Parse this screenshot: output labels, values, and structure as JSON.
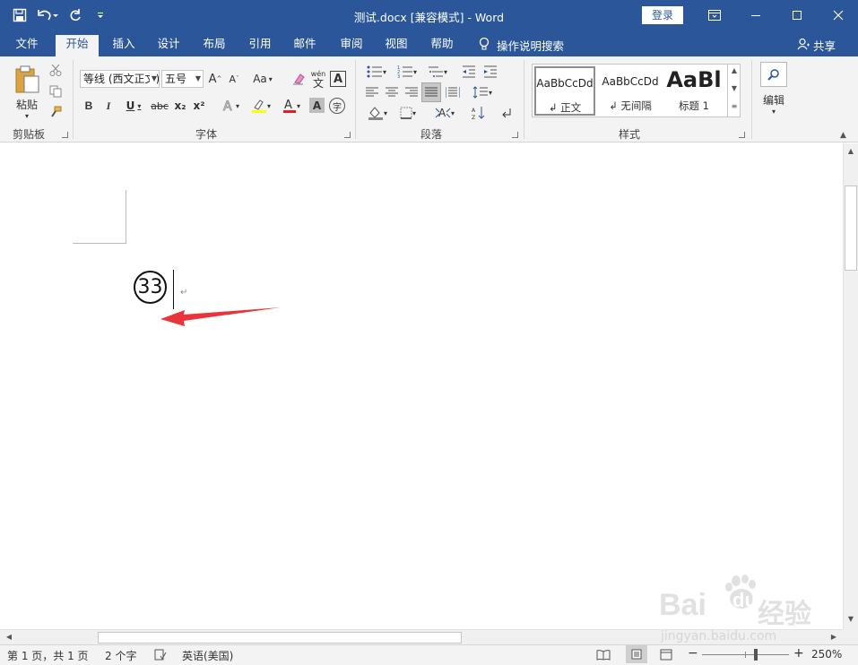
{
  "window": {
    "title": "测试.docx [兼容模式]  -  Word",
    "login_label": "登录"
  },
  "menu": {
    "tabs": [
      "文件",
      "开始",
      "插入",
      "设计",
      "布局",
      "引用",
      "邮件",
      "审阅",
      "视图",
      "帮助"
    ],
    "active_tab": "开始",
    "tell_me": "操作说明搜索",
    "share": "共享"
  },
  "ribbon": {
    "clipboard": {
      "label": "剪贴板",
      "paste": "粘贴"
    },
    "font": {
      "label": "字体",
      "font_name": "等线 (西文正文)",
      "font_size": "五号",
      "case_label": "Aa",
      "pinyin_top": "wén",
      "pinyin_bottom": "文",
      "boxed_char": "A",
      "enclose_char": "字",
      "bold": "B",
      "italic": "I",
      "underline": "U",
      "strike": "abc",
      "subscript": "x₂",
      "superscript": "x²"
    },
    "paragraph": {
      "label": "段落"
    },
    "styles": {
      "label": "样式",
      "items": [
        {
          "preview": "AaBbCcDd",
          "name": "↲ 正文"
        },
        {
          "preview": "AaBbCcDd",
          "name": "↲ 无间隔"
        },
        {
          "preview": "AaBl",
          "name": "标题 1"
        }
      ]
    },
    "editing": {
      "label": "编辑"
    }
  },
  "document": {
    "circled_text": "33",
    "paragraph_mark": "↵"
  },
  "status": {
    "page": "第 1 页，共 1 页",
    "words": "2 个字",
    "language": "英语(美国)",
    "zoom": "250%",
    "zoom_level_fraction": 0.62
  },
  "watermark": {
    "text1": "Bai",
    "text2": "du",
    "cn": "经验",
    "url": "jingyan.baidu.com"
  },
  "colors": {
    "brand": "#2b579a",
    "ribbon_bg": "#f3f3f3",
    "highlight": "#ffff00",
    "font_color": "#e51c23",
    "arrow": "#e8343a"
  }
}
